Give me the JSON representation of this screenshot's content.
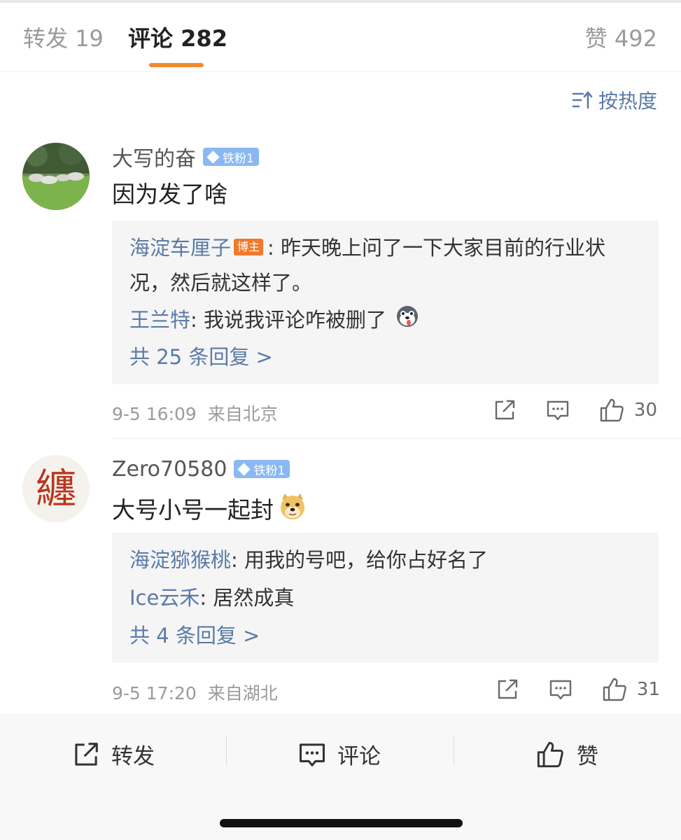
{
  "tabs": {
    "repost_label": "转发",
    "repost_count": "19",
    "comment_label": "评论",
    "comment_count": "282",
    "like_label": "赞",
    "like_count": "492"
  },
  "sort_label": "按热度",
  "comments": [
    {
      "username": "大写的奋",
      "badge": "铁粉1",
      "text": "因为发了啥",
      "replies": [
        {
          "name": "海淀车厘子",
          "badge": "博主",
          "text": "昨天晚上问了一下大家目前的行业状况，然后就这样了。"
        },
        {
          "name": "王兰特",
          "text": "我说我评论咋被删了"
        }
      ],
      "more_replies": "共 25 条回复 >",
      "time": "9-5 16:09",
      "location": "来自北京",
      "likes": "30"
    },
    {
      "username": "Zero70580",
      "badge": "铁粉1",
      "avatar_char": "纏",
      "text": "大号小号一起封",
      "replies": [
        {
          "name": "海淀猕猴桃",
          "text": "用我的号吧，给你占好名了"
        },
        {
          "name": "Ice云禾",
          "text": "居然成真"
        }
      ],
      "more_replies": "共 4 条回复 >",
      "time": "9-5 17:20",
      "location": "来自湖北",
      "likes": "31"
    }
  ],
  "bottom_bar": {
    "repost": "转发",
    "comment": "评论",
    "like": "赞"
  },
  "colors": {
    "accent": "#f08a2c",
    "link": "#5a7aa8",
    "fan_badge": "#8ab8f2",
    "host_badge": "#f07a2a"
  }
}
